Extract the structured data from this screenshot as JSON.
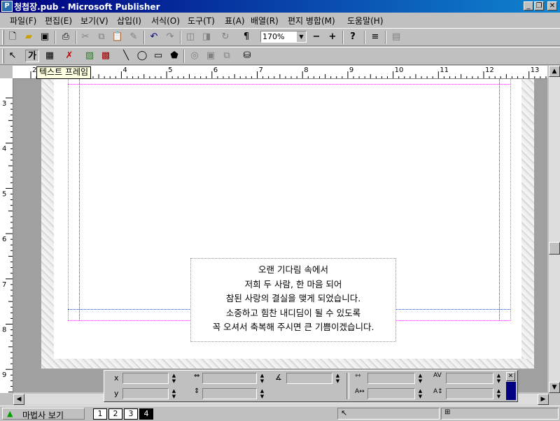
{
  "window": {
    "title": "청첩장.pub - Microsoft Publisher",
    "app_icon": "publisher-icon"
  },
  "menu": [
    "파일(F)",
    "편집(E)",
    "보기(V)",
    "삽입(I)",
    "서식(O)",
    "도구(T)",
    "표(A)",
    "배열(R)",
    "편지 병합(M)",
    "도움말(H)"
  ],
  "standard_toolbar": {
    "zoom": "170%"
  },
  "tooltip": "텍스트 프레임",
  "rulers": {
    "horizontal_ticks": [
      "2",
      "3",
      "4",
      "5",
      "6",
      "7",
      "8",
      "9",
      "10",
      "11",
      "12",
      "13"
    ],
    "vertical_ticks": [
      "3",
      "4",
      "5",
      "6",
      "7",
      "8",
      "9"
    ]
  },
  "text_frame": {
    "lines": [
      "오랜 기다림 속에서",
      "저희 두 사람, 한 마음 되어",
      "참된 사랑의 결실을 맺게 되었습니다.",
      "소중하고 힘찬 내디딤이 될 수 있도록",
      "꼭 오셔서 축복해 주시면 큰 기쁨이겠습니다."
    ]
  },
  "measurements": {
    "x_label": "x",
    "y_label": "y"
  },
  "status": {
    "wizard_label": "마법사 보기",
    "pages": [
      "1",
      "2",
      "3",
      "4"
    ],
    "active_page": "4"
  }
}
